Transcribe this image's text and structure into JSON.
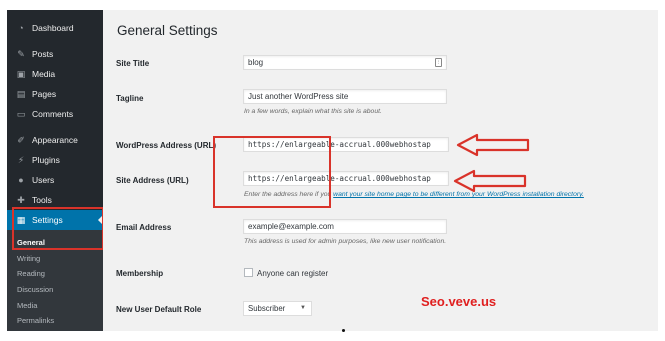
{
  "sidebar": {
    "items": [
      {
        "label": "Dashboard",
        "icon": "dashboard-icon",
        "glyph": "◔"
      },
      {
        "label": "Posts",
        "icon": "pin-icon",
        "glyph": "✎"
      },
      {
        "label": "Media",
        "icon": "media-icon",
        "glyph": "▣"
      },
      {
        "label": "Pages",
        "icon": "pages-icon",
        "glyph": "▤"
      },
      {
        "label": "Comments",
        "icon": "comment-icon",
        "glyph": "▭"
      },
      {
        "label": "Appearance",
        "icon": "brush-icon",
        "glyph": "✐"
      },
      {
        "label": "Plugins",
        "icon": "plug-icon",
        "glyph": "⚡"
      },
      {
        "label": "Users",
        "icon": "user-icon",
        "glyph": "●"
      },
      {
        "label": "Tools",
        "icon": "wrench-icon",
        "glyph": "✚"
      },
      {
        "label": "Settings",
        "icon": "settings-icon",
        "glyph": "▦"
      }
    ],
    "submenu": [
      "General",
      "Writing",
      "Reading",
      "Discussion",
      "Media",
      "Permalinks"
    ]
  },
  "page": {
    "title": "General Settings",
    "site_title": {
      "label": "Site Title",
      "value": "blog"
    },
    "tagline": {
      "label": "Tagline",
      "value": "Just another WordPress site",
      "desc": "In a few words, explain what this site is about."
    },
    "wp_address": {
      "label": "WordPress Address (URL)",
      "value": "https://enlargeable-accrual.000webhostap"
    },
    "site_address": {
      "label": "Site Address (URL)",
      "value": "https://enlargeable-accrual.000webhostap",
      "desc_prefix": "Enter the address here if you ",
      "desc_link": "want your site home page to be different from your WordPress installation directory."
    },
    "email": {
      "label": "Email Address",
      "value": "example@example.com",
      "desc": "This address is used for admin purposes, like new user notification."
    },
    "membership": {
      "label": "Membership",
      "checkbox_label": "Anyone can register"
    },
    "default_role": {
      "label": "New User Default Role",
      "value": "Subscriber"
    }
  },
  "watermark": "Seo.veve.us",
  "colors": {
    "sidebar": "#23282d",
    "active": "#0073aa",
    "highlight": "#d9332a",
    "watermark": "#e02020"
  }
}
